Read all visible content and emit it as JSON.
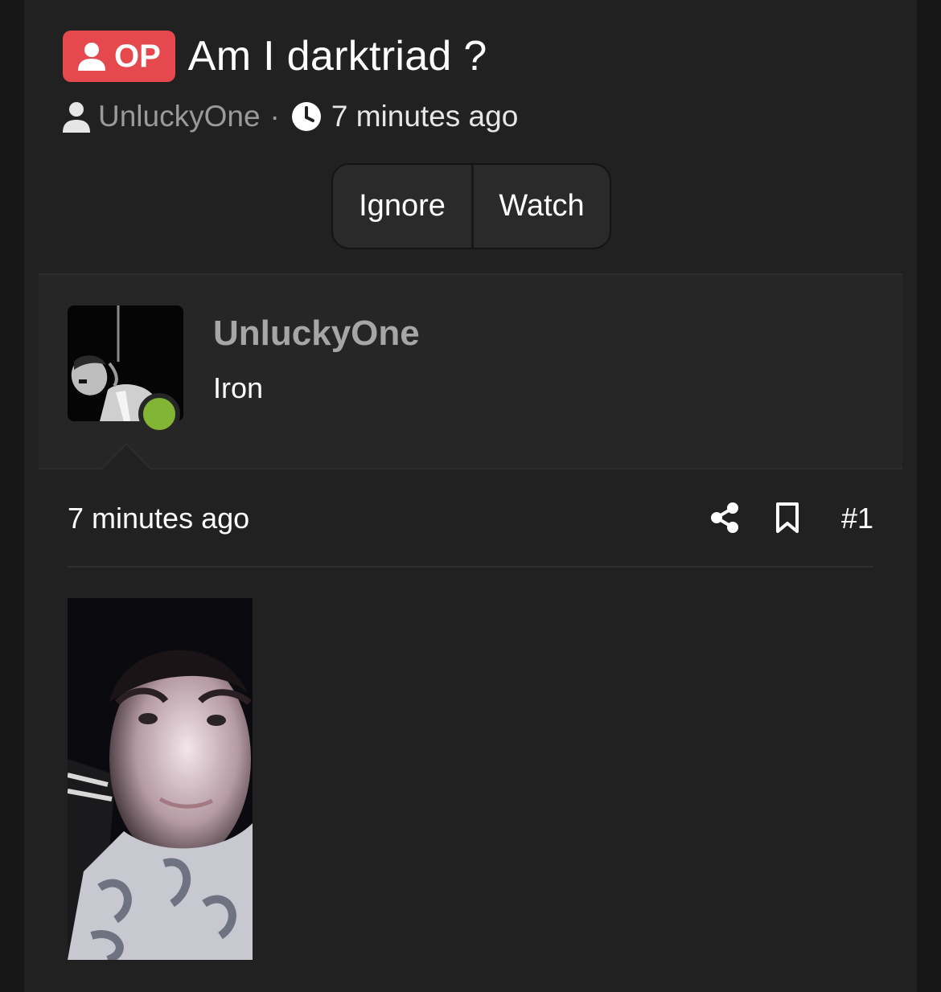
{
  "thread": {
    "op_badge": "OP",
    "title": "Am I darktriad ?",
    "author": "UnluckyOne",
    "separator": "·",
    "time": "7 minutes ago"
  },
  "actions": {
    "ignore": "Ignore",
    "watch": "Watch"
  },
  "post": {
    "username": "UnluckyOne",
    "rank": "Iron",
    "online": true,
    "time": "7 minutes ago",
    "number": "#1"
  },
  "colors": {
    "op_badge": "#e5484d",
    "online": "#82b435",
    "background": "#212121"
  },
  "icons": [
    "user-icon",
    "clock-icon",
    "share-icon",
    "bookmark-icon"
  ]
}
